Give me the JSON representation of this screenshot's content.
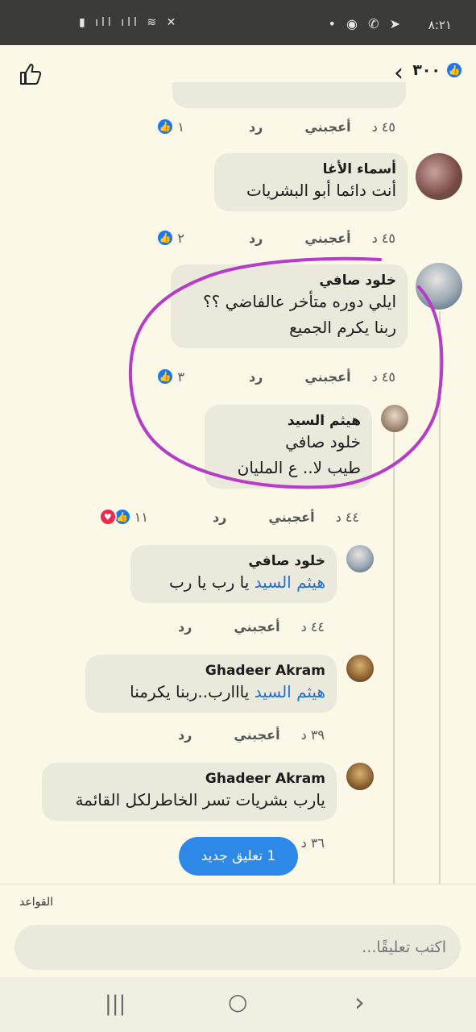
{
  "status": {
    "time": "٨:٢١",
    "left_icons": "▮ ıll ıll ≋ ✕",
    "right_icons": "• ◉ ✆ ➤"
  },
  "header": {
    "count": "٣٠٠"
  },
  "comments": [
    {
      "time": "٤٥ د",
      "like": "أعجبني",
      "reply": "رد",
      "reactions": "١"
    },
    {
      "name": "أسماء الأغا",
      "text": "أنت دائما أبو البشريات",
      "time": "٤٥ د",
      "like": "أعجبني",
      "reply": "رد",
      "reactions": "٢"
    },
    {
      "name": "خلود صافي",
      "line1": "ايلي دوره متأخر عالفاضي ؟؟",
      "line2": "ربنا يكرم الجميع",
      "time": "٤٥ د",
      "like": "أعجبني",
      "reply": "رد",
      "reactions": "٣"
    },
    {
      "name": "هيثم السيد",
      "mention": "خلود صافي",
      "text": "طيب لا.. ع المليان",
      "time": "٤٤ د",
      "like": "أعجبني",
      "reply": "رد",
      "reactions": "١١"
    },
    {
      "name": "خلود صافي",
      "mention": "هيثم السيد",
      "text": "يا رب يا رب",
      "time": "٤٤ د",
      "like": "أعجبني",
      "reply": "رد"
    },
    {
      "name": "Ghadeer Akram",
      "mention": "هيثم السيد",
      "text": "يااارب..ربنا يكرمنا",
      "time": "٣٩ د",
      "like": "أعجبني",
      "reply": "رد"
    },
    {
      "name": "Ghadeer Akram",
      "text": "يارب بشريات تسر الخاطرلكل القائمة",
      "time": "٣٦ د"
    }
  ],
  "new_comment_pill": "1 تعليق جديد",
  "composer": {
    "rules": "القواعد",
    "placeholder": "اكتب تعليقًا..."
  },
  "colors": {
    "accent": "#1877f2",
    "annotation": "#b43cc8"
  }
}
